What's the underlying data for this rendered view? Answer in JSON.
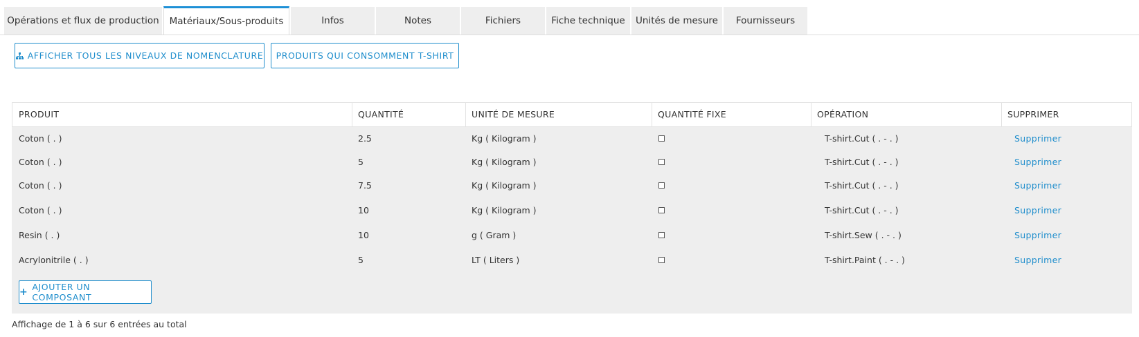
{
  "tabs": [
    {
      "label": "Opérations et flux de production",
      "active": false
    },
    {
      "label": "Matériaux/Sous-produits",
      "active": true
    },
    {
      "label": "Infos",
      "active": false
    },
    {
      "label": "Notes",
      "active": false
    },
    {
      "label": "Fichiers",
      "active": false
    },
    {
      "label": "Fiche technique",
      "active": false
    },
    {
      "label": "Unités de mesure",
      "active": false
    },
    {
      "label": "Fournisseurs",
      "active": false
    }
  ],
  "toolbar": {
    "show_levels_label": "AFFICHER TOUS LES NIVEAUX DE NOMENCLATURE",
    "show_levels_icon": "sitemap-icon",
    "consumers_label": "PRODUITS QUI CONSOMMENT T-SHIRT"
  },
  "table": {
    "columns": [
      "PRODUIT",
      "QUANTITÉ",
      "UNITÉ DE MESURE",
      "QUANTITÉ FIXE",
      "OPÉRATION",
      "SUPPRIMER"
    ],
    "rows": [
      {
        "product": "Coton ( . )",
        "quantity": "2.5",
        "unit": "Kg ( Kilogram )",
        "fixed": false,
        "operation": "T-shirt.Cut ( . - . )",
        "delete": "Supprimer"
      },
      {
        "product": "Coton ( . )",
        "quantity": "5",
        "unit": "Kg ( Kilogram )",
        "fixed": false,
        "operation": "T-shirt.Cut ( . - . )",
        "delete": "Supprimer"
      },
      {
        "product": "Coton ( . )",
        "quantity": "7.5",
        "unit": "Kg ( Kilogram )",
        "fixed": false,
        "operation": "T-shirt.Cut ( . - . )",
        "delete": "Supprimer"
      },
      {
        "product": "Coton ( . )",
        "quantity": "10",
        "unit": "Kg ( Kilogram )",
        "fixed": false,
        "operation": "T-shirt.Cut ( . - . )",
        "delete": "Supprimer"
      },
      {
        "product": "Resin ( . )",
        "quantity": "10",
        "unit": "g ( Gram )",
        "fixed": false,
        "operation": "T-shirt.Sew ( . - . )",
        "delete": "Supprimer"
      },
      {
        "product": "Acrylonitrile ( . )",
        "quantity": "5",
        "unit": "LT ( Liters )",
        "fixed": false,
        "operation": "T-shirt.Paint ( . - . )",
        "delete": "Supprimer"
      }
    ],
    "add_label": "AJOUTER UN COMPOSANT",
    "add_icon": "plus-icon"
  },
  "footer": {
    "summary": "Affichage de 1 à 6 sur 6 entrées au total"
  },
  "colors": {
    "accent": "#1e8dcc",
    "tab_active_border": "#1e90d6",
    "grid_bg": "#eeeeee"
  }
}
